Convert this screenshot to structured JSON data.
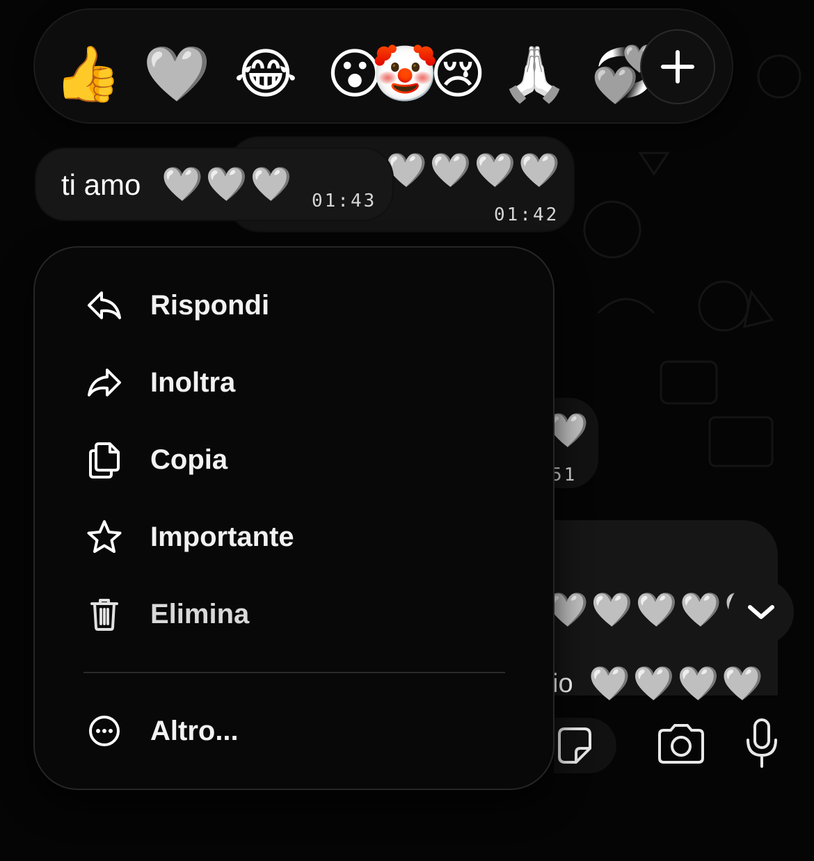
{
  "reactions": {
    "items": [
      {
        "emoji": "👍",
        "name": "thumbs-up"
      },
      {
        "emoji": "🩶",
        "name": "grey-heart"
      },
      {
        "emoji": "😂",
        "name": "tears-of-joy"
      },
      {
        "emoji": "😮",
        "name": "surprised"
      },
      {
        "emoji": "🤡",
        "name": "clown"
      },
      {
        "emoji": "😢",
        "name": "crying"
      },
      {
        "emoji": "🙏",
        "name": "folded-hands"
      },
      {
        "emoji": "💞",
        "name": "revolving-hearts"
      }
    ],
    "add_icon": "plus-icon"
  },
  "messages": {
    "selected": {
      "text": "ti amo",
      "hearts": "🩶🩶🩶",
      "time": "01:43"
    },
    "behind": {
      "hearts": "🩶🩶🩶🩶",
      "time": "01:42"
    },
    "lower_time_fragment": "51",
    "lower_text_fragment": "io",
    "lower_hearts": "🩶🩶🩶🩶",
    "mid_hearts": "🩶🩶🩶🩶🩶"
  },
  "menu": {
    "items": [
      {
        "label": "Rispondi",
        "icon": "reply-icon"
      },
      {
        "label": "Inoltra",
        "icon": "forward-icon"
      },
      {
        "label": "Copia",
        "icon": "copy-icon"
      },
      {
        "label": "Importante",
        "icon": "star-icon"
      },
      {
        "label": "Elimina",
        "icon": "trash-icon"
      }
    ],
    "more": {
      "label": "Altro...",
      "icon": "more-icon"
    }
  },
  "colors": {
    "background": "#050505",
    "surface": "#141414",
    "text": "#f2f2f2"
  }
}
